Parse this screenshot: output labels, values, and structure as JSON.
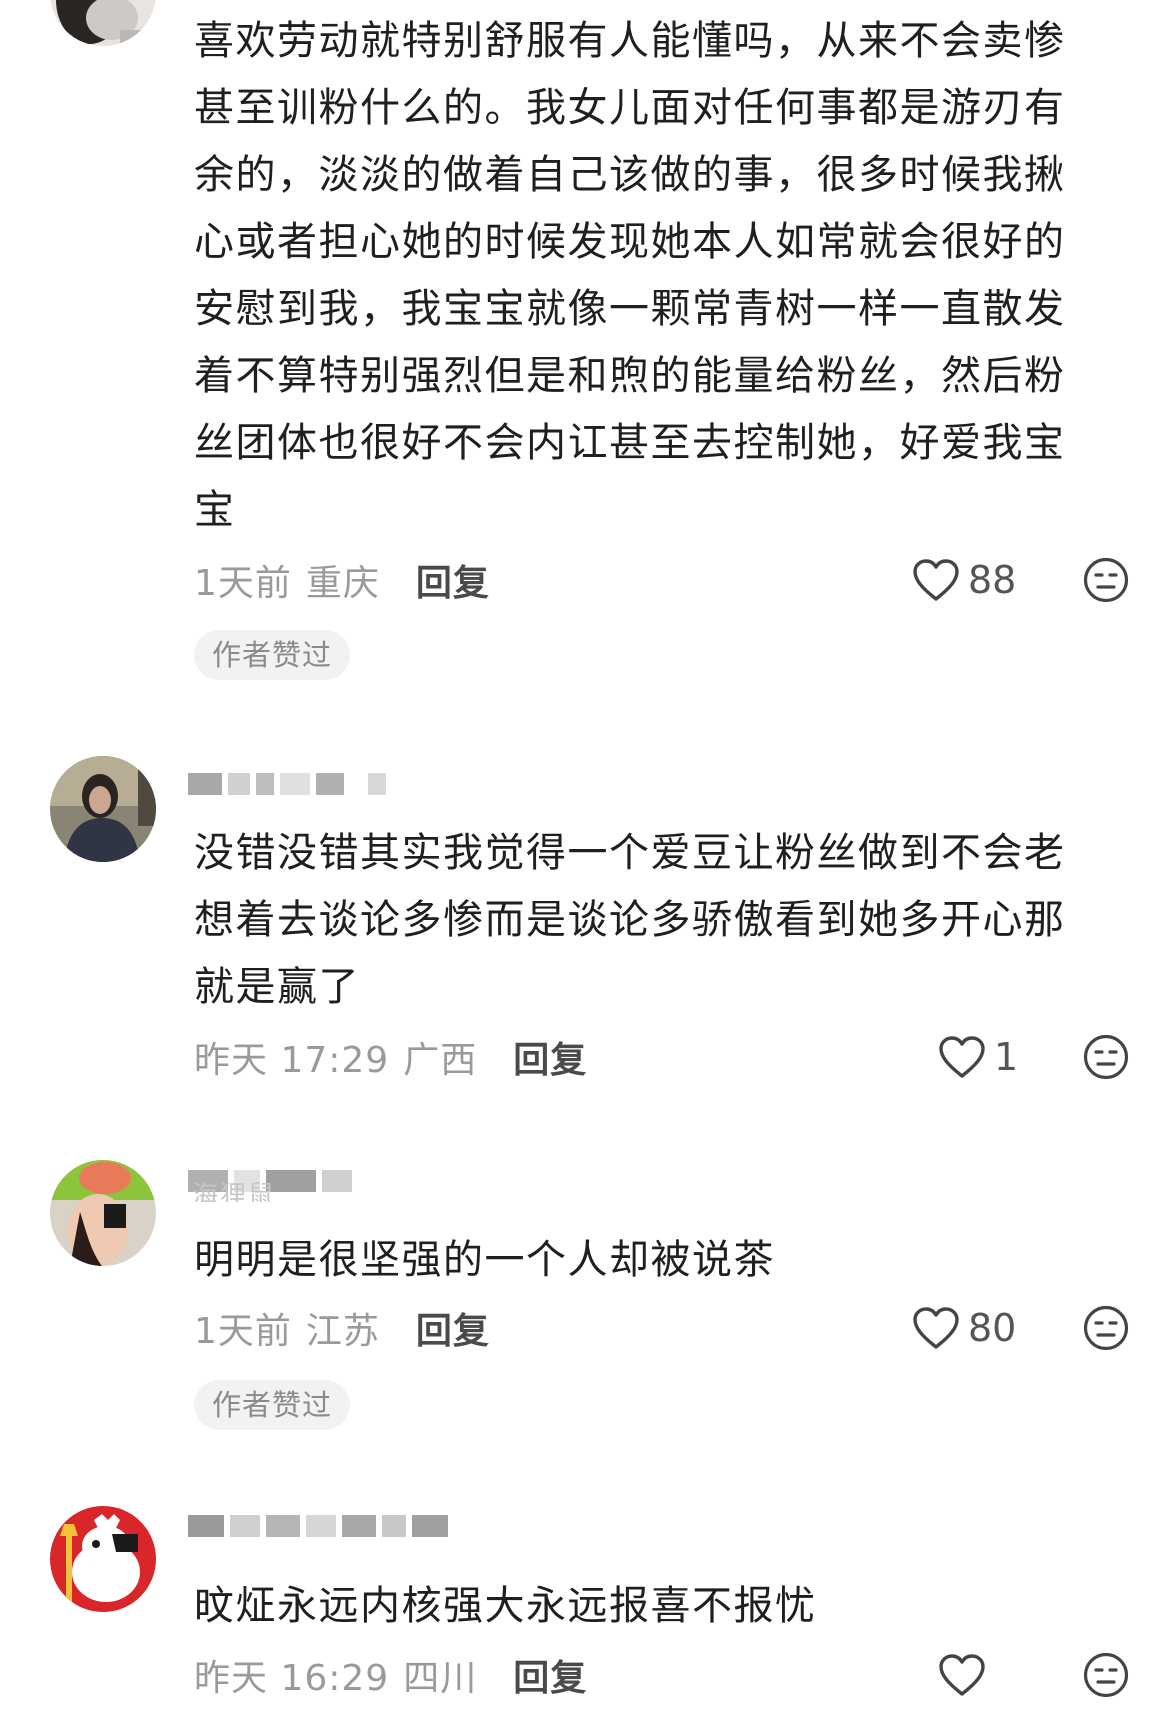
{
  "comments": [
    {
      "text": "喜欢劳动就特别舒服有人能懂吗，从来不会卖惨甚至训粉什么的。我女儿面对任何事都是游刃有余的，淡淡的做着自己该做的事，很多时候我揪心或者担心她的时候发现她本人如常就会很好的安慰到我，我宝宝就像一颗常青树一样一直散发着不算特别强烈但是和煦的能量给粉丝，然后粉丝团体也很好不会内讧甚至去控制她，好爱我宝宝",
      "time": "1天前",
      "location": "重庆",
      "reply_label": "回复",
      "likes": "88",
      "badge": "作者赞过"
    },
    {
      "text": "没错没错其实我觉得一个爱豆让粉丝做到不会老想着去谈论多惨而是谈论多骄傲看到她多开心那就是赢了",
      "time": "昨天 17:29",
      "location": "广西",
      "reply_label": "回复",
      "likes": "1"
    },
    {
      "username_partial": "海狸鼠",
      "text": "明明是很坚强的一个人却被说茶",
      "time": "1天前",
      "location": "江苏",
      "reply_label": "回复",
      "likes": "80",
      "badge": "作者赞过"
    },
    {
      "text": "旼炡永远内核强大永远报喜不报忧",
      "time": "昨天 16:29",
      "location": "四川",
      "reply_label": "回复",
      "likes": ""
    }
  ],
  "icons": {
    "like": "heart-outline-icon",
    "dislike": "neutral-face-icon"
  },
  "colors": {
    "text": "#1f1f1f",
    "meta": "#9a9a9a",
    "reply": "#4a4a4a",
    "badge_bg": "#f2f2f2"
  }
}
